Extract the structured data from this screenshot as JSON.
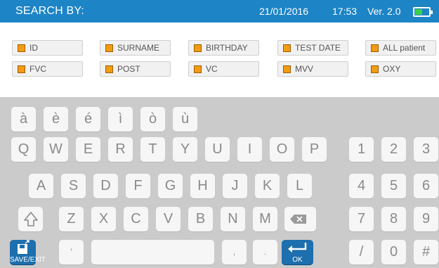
{
  "header": {
    "title": "SEARCH BY:",
    "date": "21/01/2016",
    "time": "17:53",
    "version": "Ver. 2.0",
    "battery_icon": "battery-icon"
  },
  "filters": [
    {
      "label": "ID"
    },
    {
      "label": "SURNAME"
    },
    {
      "label": "BIRTHDAY"
    },
    {
      "label": "TEST DATE"
    },
    {
      "label": "ALL patient"
    },
    {
      "label": "FVC"
    },
    {
      "label": "POST"
    },
    {
      "label": "VC"
    },
    {
      "label": "MVV"
    },
    {
      "label": "OXY"
    }
  ],
  "keyboard": {
    "accents": [
      "à",
      "è",
      "é",
      "ì",
      "ò",
      "ù"
    ],
    "row1": [
      "Q",
      "W",
      "E",
      "R",
      "T",
      "Y",
      "U",
      "I",
      "O",
      "P"
    ],
    "row2": [
      "A",
      "S",
      "D",
      "F",
      "G",
      "H",
      "J",
      "K",
      "L"
    ],
    "row3": [
      "Z",
      "X",
      "C",
      "V",
      "B",
      "N",
      "M"
    ],
    "numpad": [
      "1",
      "2",
      "3",
      "4",
      "5",
      "6",
      "7",
      "8",
      "9",
      "/",
      "0",
      "#"
    ],
    "apostrophe": "'",
    "comma": ",",
    "period": ".",
    "save_label": "SAVE/EXIT",
    "ok_label": "OK",
    "colors": {
      "header": "#1d84c6",
      "action_key": "#1d6fae",
      "checkbox": "#f39b12",
      "battery": "#39d24a"
    }
  }
}
